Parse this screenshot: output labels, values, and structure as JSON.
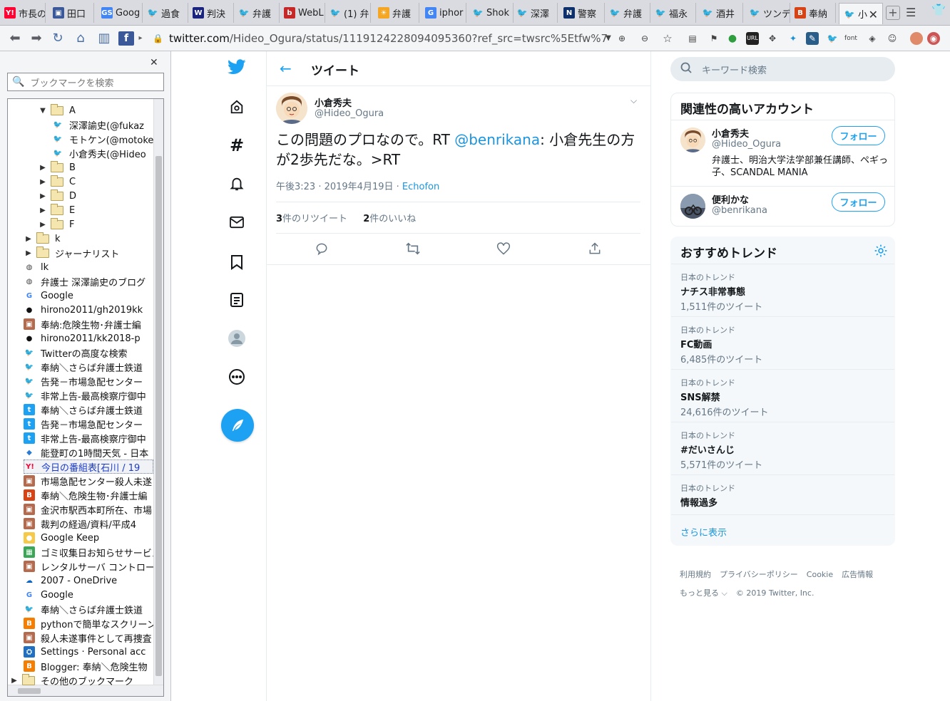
{
  "tabs": [
    {
      "label": "市長の",
      "fav": "Y!",
      "color": "#ff0033"
    },
    {
      "label": "田口",
      "fav": "▣",
      "color": "#3b5998"
    },
    {
      "label": "Goog",
      "fav": "GS",
      "color": "#4285f4"
    },
    {
      "label": "過食",
      "fav": "t",
      "color": "#1da1f2"
    },
    {
      "label": "判決",
      "fav": "W",
      "color": "#1a237e"
    },
    {
      "label": "弁護",
      "fav": "t",
      "color": "#1da1f2"
    },
    {
      "label": "WebL",
      "fav": "b",
      "color": "#c62828"
    },
    {
      "label": "(1) 弁",
      "fav": "t",
      "color": "#1da1f2"
    },
    {
      "label": "弁護",
      "fav": "☀",
      "color": "#f5a623"
    },
    {
      "label": "iphor",
      "fav": "G",
      "color": "#4285f4"
    },
    {
      "label": "Shok",
      "fav": "t",
      "color": "#1da1f2"
    },
    {
      "label": "深澤",
      "fav": "t",
      "color": "#1da1f2"
    },
    {
      "label": "警察",
      "fav": "N",
      "color": "#0d2f6b"
    },
    {
      "label": "弁護",
      "fav": "t",
      "color": "#1da1f2"
    },
    {
      "label": "福永",
      "fav": "t",
      "color": "#1da1f2"
    },
    {
      "label": "酒井",
      "fav": "t",
      "color": "#1da1f2"
    },
    {
      "label": "ツンデ",
      "fav": "t",
      "color": "#1da1f2"
    },
    {
      "label": "奉納",
      "fav": "B",
      "color": "#d84315"
    },
    {
      "label": "小",
      "fav": "t",
      "color": "#1da1f2",
      "active": true
    }
  ],
  "url": {
    "host": "twitter.com",
    "rest": "/Hideo_Ogura/status/1119124228094095360?ref_src=twsrc%5Etfw%7Ctw…"
  },
  "sidebar": {
    "search_placeholder": "ブックマークを検索",
    "items": [
      {
        "label": "A",
        "type": "folder-open",
        "indent": 1
      },
      {
        "label": "深澤諭史(@fukaz",
        "type": "twitter",
        "indent": 3
      },
      {
        "label": "モトケン(@motoke",
        "type": "twitter",
        "indent": 3
      },
      {
        "label": "小倉秀夫(@Hideo",
        "type": "twitter",
        "indent": 3
      },
      {
        "label": "B",
        "type": "folder",
        "indent": 1
      },
      {
        "label": "C",
        "type": "folder",
        "indent": 1
      },
      {
        "label": "D",
        "type": "folder",
        "indent": 1
      },
      {
        "label": "E",
        "type": "folder",
        "indent": 1
      },
      {
        "label": "F",
        "type": "folder",
        "indent": 1
      },
      {
        "label": "k",
        "type": "folder",
        "indent": 0
      },
      {
        "label": "ジャーナリスト",
        "type": "folder",
        "indent": 0
      },
      {
        "label": "lk",
        "type": "globe",
        "indent": 0
      },
      {
        "label": "弁護士 深澤諭史のブログ",
        "type": "globe",
        "indent": 0
      },
      {
        "label": "Google",
        "type": "google",
        "indent": 0
      },
      {
        "label": "hirono2011/gh2019kk",
        "type": "github",
        "indent": 0
      },
      {
        "label": "奉納:危険生物･弁護士編",
        "type": "img",
        "indent": 0
      },
      {
        "label": "hirono2011/kk2018-p",
        "type": "github",
        "indent": 0
      },
      {
        "label": "Twitterの高度な検索",
        "type": "twitter",
        "indent": 0
      },
      {
        "label": "奉納＼さらば弁護士鉄道",
        "type": "twitter",
        "indent": 0
      },
      {
        "label": "告発－市場急配センター",
        "type": "twitter",
        "indent": 0
      },
      {
        "label": "非常上告-最高検察庁御中",
        "type": "twitter",
        "indent": 0
      },
      {
        "label": "奉納＼さらば弁護士鉄道",
        "type": "tw-t",
        "indent": 0
      },
      {
        "label": "告発－市場急配センター",
        "type": "tw-t",
        "indent": 0
      },
      {
        "label": "非常上告-最高検察庁御中",
        "type": "tw-t",
        "indent": 0
      },
      {
        "label": "能登町の1時間天気 - 日本",
        "type": "cube",
        "indent": 0
      },
      {
        "label": "今日の番組表[石川 / 19",
        "type": "yahoo",
        "indent": 0,
        "selected": true
      },
      {
        "label": "市場急配センター殺人未遂",
        "type": "img",
        "indent": 0
      },
      {
        "label": "奉納＼危険生物･弁護士編",
        "type": "blogger-b",
        "indent": 0
      },
      {
        "label": "金沢市駅西本町所在、市場",
        "type": "img",
        "indent": 0
      },
      {
        "label": "裁判の経過/資料/平成4",
        "type": "img",
        "indent": 0
      },
      {
        "label": "Google Keep",
        "type": "keep",
        "indent": 0
      },
      {
        "label": "ゴミ収集日お知らせサービス",
        "type": "calendar",
        "indent": 0
      },
      {
        "label": "レンタルサーバ コントロール",
        "type": "img",
        "indent": 0
      },
      {
        "label": "2007 - OneDrive",
        "type": "onedrive",
        "indent": 0
      },
      {
        "label": "Google",
        "type": "google",
        "indent": 0
      },
      {
        "label": "奉納＼さらば弁護士鉄道",
        "type": "twitter",
        "indent": 0
      },
      {
        "label": "pythonで簡単なスクリーン",
        "type": "blogger",
        "indent": 0
      },
      {
        "label": "殺人未遂事件として再捜査",
        "type": "img",
        "indent": 0
      },
      {
        "label": "Settings · Personal acc",
        "type": "settings",
        "indent": 0
      },
      {
        "label": "Blogger: 奉納＼危険生物",
        "type": "blogger",
        "indent": 0
      },
      {
        "label": "その他のブックマーク",
        "type": "folder",
        "indent": -1
      }
    ]
  },
  "header": {
    "title": "ツイート"
  },
  "tweet": {
    "name": "小倉秀夫",
    "handle": "@Hideo_Ogura",
    "text_before": "この問題のプロなので。RT ",
    "mention": "@benrikana",
    "text_after": ": 小倉先生の方が2歩先だな。>RT",
    "time": "午後3:23 · 2019年4月19日 · ",
    "source": "Echofon",
    "retweets_count": "3",
    "retweets_label": "件のリツイート",
    "likes_count": "2",
    "likes_label": "件のいいね"
  },
  "search": {
    "placeholder": "キーワード検索"
  },
  "related": {
    "title": "関連性の高いアカウント",
    "accounts": [
      {
        "name": "小倉秀夫",
        "handle": "@Hideo_Ogura",
        "bio": "弁護士、明治大学法学部兼任講師、ペギっ子、SCANDAL MANIA",
        "follow": "フォロー"
      },
      {
        "name": "便利かな",
        "handle": "@benrikana",
        "bio": "",
        "follow": "フォロー"
      }
    ]
  },
  "trends": {
    "title": "おすすめトレンド",
    "items": [
      {
        "loc": "日本のトレンド",
        "name": "ナチス非常事態",
        "count": "1,511件のツイート"
      },
      {
        "loc": "日本のトレンド",
        "name": "FC動画",
        "count": "6,485件のツイート"
      },
      {
        "loc": "日本のトレンド",
        "name": "SNS解禁",
        "count": "24,616件のツイート"
      },
      {
        "loc": "日本のトレンド",
        "name": "#だいさんじ",
        "count": "5,571件のツイート"
      },
      {
        "loc": "日本のトレンド",
        "name": "情報過多",
        "count": ""
      }
    ],
    "more": "さらに表示"
  },
  "footer": {
    "links": [
      "利用規約",
      "プライバシーポリシー",
      "Cookie",
      "広告情報"
    ],
    "more": "もっと見る ⌵",
    "copyright": "© 2019 Twitter, Inc."
  },
  "colors": {
    "twitter_blue": "#1da1f2",
    "link": "#1b95e0",
    "secondary_text": "#657786"
  }
}
